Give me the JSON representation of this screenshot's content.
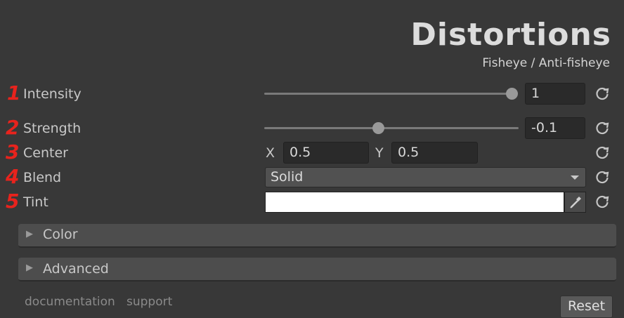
{
  "header": {
    "title": "Distortions",
    "subtitle": "Fisheye / Anti-fisheye"
  },
  "rows": [
    {
      "number": "1",
      "label": "Intensity",
      "value": "1",
      "slider_fraction": 1.0
    },
    {
      "number": "2",
      "label": "Strength",
      "value": "-0.1",
      "slider_fraction": 0.45
    },
    {
      "number": "3",
      "label": "Center",
      "x_label": "X",
      "x_value": "0.5",
      "y_label": "Y",
      "y_value": "0.5"
    },
    {
      "number": "4",
      "label": "Blend",
      "selected": "Solid"
    },
    {
      "number": "5",
      "label": "Tint",
      "color": "#ffffff"
    }
  ],
  "foldouts": [
    {
      "label": "Color",
      "expanded": false
    },
    {
      "label": "Advanced",
      "expanded": false
    }
  ],
  "footer": {
    "doc_link": "documentation",
    "support_link": "support",
    "reset_label": "Reset"
  },
  "colors": {
    "number_accent": "#e8231d",
    "background": "#383838"
  },
  "icons": {
    "reset": "reset-icon",
    "picker": "eyedropper-icon",
    "foldout": "triangle-right-icon",
    "dropdown": "chevron-down-icon"
  }
}
